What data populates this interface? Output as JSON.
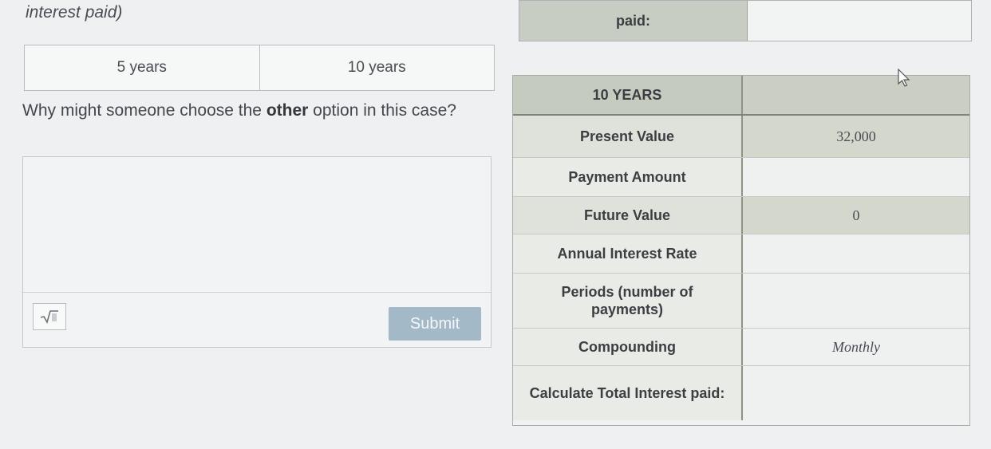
{
  "question": {
    "heading_fragment": "interest paid)",
    "options": [
      "5 years",
      "10 years"
    ],
    "prompt_before": "Why might someone choose the ",
    "prompt_bold": "other",
    "prompt_after": " option in this case?",
    "answer_value": "",
    "submit_label": "Submit",
    "math_icon": "square-root-icon"
  },
  "top_table": {
    "label": "paid:",
    "value": ""
  },
  "loan_table": {
    "header": {
      "label": "10 YEARS",
      "value": ""
    },
    "rows": [
      {
        "label": "Present Value",
        "value": "32,000",
        "shade": true
      },
      {
        "label": "Payment Amount",
        "value": "",
        "shade": false
      },
      {
        "label": "Future Value",
        "value": "0",
        "shade": true
      },
      {
        "label": "Annual Interest Rate",
        "value": "",
        "shade": false
      },
      {
        "label": "Periods (number of payments)",
        "value": "",
        "shade": false
      },
      {
        "label": "Compounding",
        "value": "Monthly",
        "shade": false,
        "italic": true
      },
      {
        "label": "Calculate Total Interest paid:",
        "value": "",
        "shade": false
      }
    ]
  },
  "icons": {
    "cursor": "mouse-pointer-icon"
  }
}
